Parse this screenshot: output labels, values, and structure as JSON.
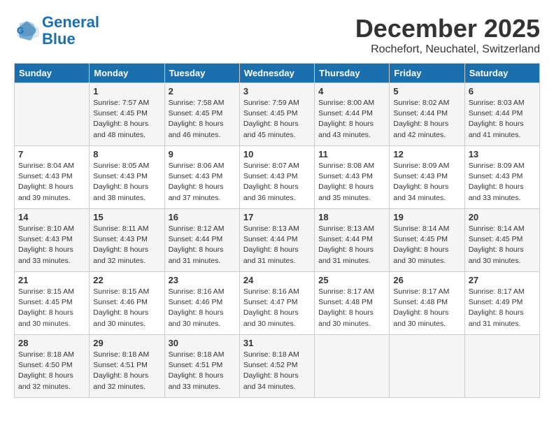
{
  "logo": {
    "line1": "General",
    "line2": "Blue"
  },
  "title": "December 2025",
  "location": "Rochefort, Neuchatel, Switzerland",
  "weekdays": [
    "Sunday",
    "Monday",
    "Tuesday",
    "Wednesday",
    "Thursday",
    "Friday",
    "Saturday"
  ],
  "weeks": [
    [
      {
        "day": "",
        "sunrise": "",
        "sunset": "",
        "daylight": ""
      },
      {
        "day": "1",
        "sunrise": "Sunrise: 7:57 AM",
        "sunset": "Sunset: 4:45 PM",
        "daylight": "Daylight: 8 hours and 48 minutes."
      },
      {
        "day": "2",
        "sunrise": "Sunrise: 7:58 AM",
        "sunset": "Sunset: 4:45 PM",
        "daylight": "Daylight: 8 hours and 46 minutes."
      },
      {
        "day": "3",
        "sunrise": "Sunrise: 7:59 AM",
        "sunset": "Sunset: 4:45 PM",
        "daylight": "Daylight: 8 hours and 45 minutes."
      },
      {
        "day": "4",
        "sunrise": "Sunrise: 8:00 AM",
        "sunset": "Sunset: 4:44 PM",
        "daylight": "Daylight: 8 hours and 43 minutes."
      },
      {
        "day": "5",
        "sunrise": "Sunrise: 8:02 AM",
        "sunset": "Sunset: 4:44 PM",
        "daylight": "Daylight: 8 hours and 42 minutes."
      },
      {
        "day": "6",
        "sunrise": "Sunrise: 8:03 AM",
        "sunset": "Sunset: 4:44 PM",
        "daylight": "Daylight: 8 hours and 41 minutes."
      }
    ],
    [
      {
        "day": "7",
        "sunrise": "Sunrise: 8:04 AM",
        "sunset": "Sunset: 4:43 PM",
        "daylight": "Daylight: 8 hours and 39 minutes."
      },
      {
        "day": "8",
        "sunrise": "Sunrise: 8:05 AM",
        "sunset": "Sunset: 4:43 PM",
        "daylight": "Daylight: 8 hours and 38 minutes."
      },
      {
        "day": "9",
        "sunrise": "Sunrise: 8:06 AM",
        "sunset": "Sunset: 4:43 PM",
        "daylight": "Daylight: 8 hours and 37 minutes."
      },
      {
        "day": "10",
        "sunrise": "Sunrise: 8:07 AM",
        "sunset": "Sunset: 4:43 PM",
        "daylight": "Daylight: 8 hours and 36 minutes."
      },
      {
        "day": "11",
        "sunrise": "Sunrise: 8:08 AM",
        "sunset": "Sunset: 4:43 PM",
        "daylight": "Daylight: 8 hours and 35 minutes."
      },
      {
        "day": "12",
        "sunrise": "Sunrise: 8:09 AM",
        "sunset": "Sunset: 4:43 PM",
        "daylight": "Daylight: 8 hours and 34 minutes."
      },
      {
        "day": "13",
        "sunrise": "Sunrise: 8:09 AM",
        "sunset": "Sunset: 4:43 PM",
        "daylight": "Daylight: 8 hours and 33 minutes."
      }
    ],
    [
      {
        "day": "14",
        "sunrise": "Sunrise: 8:10 AM",
        "sunset": "Sunset: 4:43 PM",
        "daylight": "Daylight: 8 hours and 33 minutes."
      },
      {
        "day": "15",
        "sunrise": "Sunrise: 8:11 AM",
        "sunset": "Sunset: 4:43 PM",
        "daylight": "Daylight: 8 hours and 32 minutes."
      },
      {
        "day": "16",
        "sunrise": "Sunrise: 8:12 AM",
        "sunset": "Sunset: 4:44 PM",
        "daylight": "Daylight: 8 hours and 31 minutes."
      },
      {
        "day": "17",
        "sunrise": "Sunrise: 8:13 AM",
        "sunset": "Sunset: 4:44 PM",
        "daylight": "Daylight: 8 hours and 31 minutes."
      },
      {
        "day": "18",
        "sunrise": "Sunrise: 8:13 AM",
        "sunset": "Sunset: 4:44 PM",
        "daylight": "Daylight: 8 hours and 31 minutes."
      },
      {
        "day": "19",
        "sunrise": "Sunrise: 8:14 AM",
        "sunset": "Sunset: 4:45 PM",
        "daylight": "Daylight: 8 hours and 30 minutes."
      },
      {
        "day": "20",
        "sunrise": "Sunrise: 8:14 AM",
        "sunset": "Sunset: 4:45 PM",
        "daylight": "Daylight: 8 hours and 30 minutes."
      }
    ],
    [
      {
        "day": "21",
        "sunrise": "Sunrise: 8:15 AM",
        "sunset": "Sunset: 4:45 PM",
        "daylight": "Daylight: 8 hours and 30 minutes."
      },
      {
        "day": "22",
        "sunrise": "Sunrise: 8:15 AM",
        "sunset": "Sunset: 4:46 PM",
        "daylight": "Daylight: 8 hours and 30 minutes."
      },
      {
        "day": "23",
        "sunrise": "Sunrise: 8:16 AM",
        "sunset": "Sunset: 4:46 PM",
        "daylight": "Daylight: 8 hours and 30 minutes."
      },
      {
        "day": "24",
        "sunrise": "Sunrise: 8:16 AM",
        "sunset": "Sunset: 4:47 PM",
        "daylight": "Daylight: 8 hours and 30 minutes."
      },
      {
        "day": "25",
        "sunrise": "Sunrise: 8:17 AM",
        "sunset": "Sunset: 4:48 PM",
        "daylight": "Daylight: 8 hours and 30 minutes."
      },
      {
        "day": "26",
        "sunrise": "Sunrise: 8:17 AM",
        "sunset": "Sunset: 4:48 PM",
        "daylight": "Daylight: 8 hours and 30 minutes."
      },
      {
        "day": "27",
        "sunrise": "Sunrise: 8:17 AM",
        "sunset": "Sunset: 4:49 PM",
        "daylight": "Daylight: 8 hours and 31 minutes."
      }
    ],
    [
      {
        "day": "28",
        "sunrise": "Sunrise: 8:18 AM",
        "sunset": "Sunset: 4:50 PM",
        "daylight": "Daylight: 8 hours and 32 minutes."
      },
      {
        "day": "29",
        "sunrise": "Sunrise: 8:18 AM",
        "sunset": "Sunset: 4:51 PM",
        "daylight": "Daylight: 8 hours and 32 minutes."
      },
      {
        "day": "30",
        "sunrise": "Sunrise: 8:18 AM",
        "sunset": "Sunset: 4:51 PM",
        "daylight": "Daylight: 8 hours and 33 minutes."
      },
      {
        "day": "31",
        "sunrise": "Sunrise: 8:18 AM",
        "sunset": "Sunset: 4:52 PM",
        "daylight": "Daylight: 8 hours and 34 minutes."
      },
      {
        "day": "",
        "sunrise": "",
        "sunset": "",
        "daylight": ""
      },
      {
        "day": "",
        "sunrise": "",
        "sunset": "",
        "daylight": ""
      },
      {
        "day": "",
        "sunrise": "",
        "sunset": "",
        "daylight": ""
      }
    ]
  ]
}
